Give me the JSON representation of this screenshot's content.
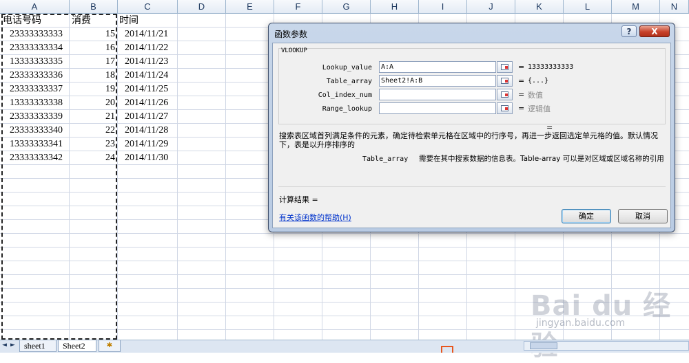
{
  "sheet": {
    "columns": [
      "A",
      "B",
      "C",
      "D",
      "E",
      "F",
      "G",
      "H",
      "I",
      "J",
      "K",
      "L",
      "M",
      "N"
    ],
    "header_row": {
      "a": "电话号码",
      "b": "消费",
      "c": "时间"
    },
    "rows": [
      {
        "phone": "23333333333",
        "amount": "15",
        "date": "2014/11/21"
      },
      {
        "phone": "23333333334",
        "amount": "16",
        "date": "2014/11/22"
      },
      {
        "phone": "13333333335",
        "amount": "17",
        "date": "2014/11/23"
      },
      {
        "phone": "23333333336",
        "amount": "18",
        "date": "2014/11/24"
      },
      {
        "phone": "23333333337",
        "amount": "19",
        "date": "2014/11/25"
      },
      {
        "phone": "13333333338",
        "amount": "20",
        "date": "2014/11/26"
      },
      {
        "phone": "23333333339",
        "amount": "21",
        "date": "2014/11/27"
      },
      {
        "phone": "23333333340",
        "amount": "22",
        "date": "2014/11/28"
      },
      {
        "phone": "13333333341",
        "amount": "23",
        "date": "2014/11/29"
      },
      {
        "phone": "23333333342",
        "amount": "24",
        "date": "2014/11/30"
      }
    ]
  },
  "tabs": {
    "items": [
      "sheet1",
      "Sheet2"
    ],
    "active": "Sheet2",
    "nav_first": "◄",
    "nav_last": "►",
    "new_sheet_icon": "new-sheet-icon"
  },
  "dialog": {
    "title": "函数参数",
    "help_button": "?",
    "close_button": "X",
    "function_name": "VLOOKUP",
    "args": [
      {
        "label": "Lookup_value",
        "value": "A:A",
        "result": "13333333333",
        "result_gray": false
      },
      {
        "label": "Table_array",
        "value": "Sheet2!A:B",
        "result": "{...}",
        "result_gray": false
      },
      {
        "label": "Col_index_num",
        "value": "",
        "result": "数值",
        "result_gray": true
      },
      {
        "label": "Range_lookup",
        "value": "",
        "result": "逻辑值",
        "result_gray": true
      }
    ],
    "equals": "=",
    "description": "搜索表区域首列满足条件的元素，确定待检索单元格在区域中的行序号，再进一步返回选定单元格的值。默认情况下，表是以升序排序的",
    "arg_desc_name": "Table_array",
    "arg_desc_text": "需要在其中搜索数据的信息表。Table-array 可以是对区域或区域名称的引用",
    "calc_result_label": "计算结果 =",
    "help_link": "有关该函数的帮助(H)",
    "ok_label": "确定",
    "cancel_label": "取消"
  },
  "watermark": {
    "big": "Bai du 经验",
    "small": "jingyan.baidu.com"
  }
}
